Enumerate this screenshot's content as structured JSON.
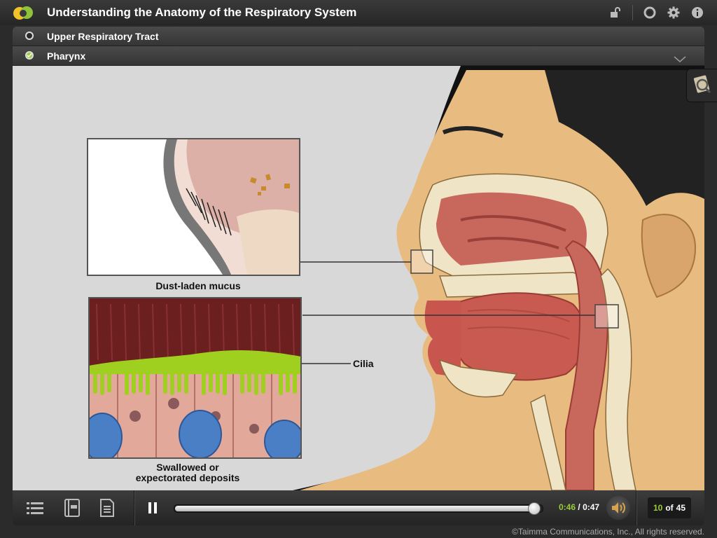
{
  "app": {
    "title": "Understanding the Anatomy of the Respiratory System",
    "logo_icon": "logo-icon"
  },
  "toolbar": {
    "icons": [
      "unlock-icon",
      "help-lifebuoy-icon",
      "gear-icon",
      "info-icon"
    ]
  },
  "breadcrumbs": [
    {
      "label": "Upper Respiratory Tract",
      "status": "open"
    },
    {
      "label": "Pharynx",
      "status": "completed"
    }
  ],
  "illustration": {
    "labels": {
      "dust": "Dust-laden mucus",
      "cilia": "Cilia",
      "swallowed_line1": "Swallowed or",
      "swallowed_line2": "expectorated deposits"
    }
  },
  "side_tab": {
    "icon": "magnifier-icon"
  },
  "player": {
    "menu_icon": "menu-list-icon",
    "glossary_icon": "glossary-book-icon",
    "notes_icon": "notes-document-icon",
    "play_state_icon": "pause-icon",
    "progress_fraction": 0.975,
    "current_time": "0:46",
    "separator": "/",
    "total_time": "0:47",
    "volume_icon": "volume-icon",
    "page_current": "10",
    "page_of": "of",
    "page_total": "45"
  },
  "footer": {
    "copyright": "©Taimma Communications, Inc., All rights reserved."
  },
  "colors": {
    "accent_green": "#9ccc3a",
    "skin": "#e8bb80",
    "tissue": "#c85a52",
    "bone": "#f0e4c6",
    "cilia_green": "#9fd020",
    "nucleus_blue": "#4a7fc6"
  }
}
